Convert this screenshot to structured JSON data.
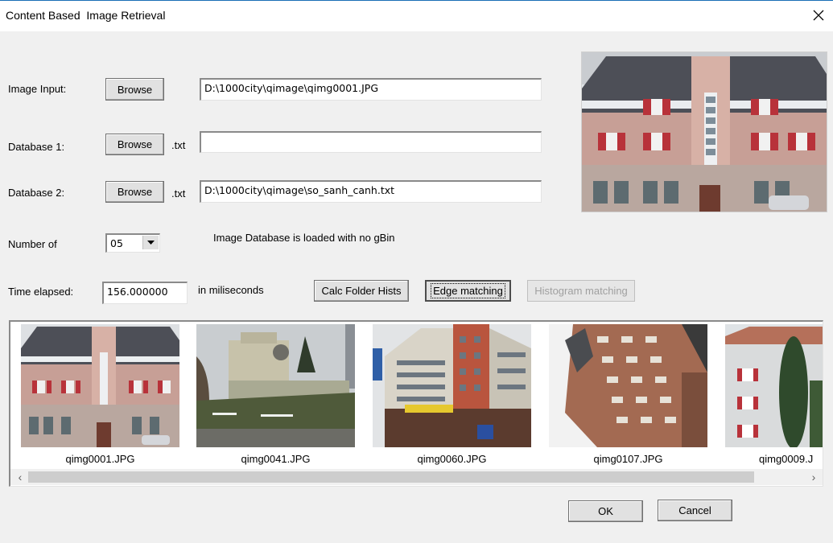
{
  "window": {
    "title": "Content Based  Image Retrieval",
    "close_icon": "close-icon"
  },
  "image_input": {
    "label": "Image Input:",
    "browse_label": "Browse",
    "path": "D:\\1000city\\qimage\\qimg0001.JPG"
  },
  "database1": {
    "label": "Database 1:",
    "browse_label": "Browse",
    "ext_label": ".txt",
    "path": ""
  },
  "database2": {
    "label": "Database 2:",
    "browse_label": "Browse",
    "ext_label": ".txt",
    "path": "D:\\1000city\\qimage\\so_sanh_canh.txt"
  },
  "number_of": {
    "label": "Number of",
    "selected": "05"
  },
  "status_text": "Image Database is loaded with no gBin",
  "time": {
    "label": "Time elapsed:",
    "value": "156.000000",
    "unit_label": "in miliseconds"
  },
  "actions": {
    "calc_label": "Calc Folder Hists",
    "edge_label": "Edge matching",
    "histogram_label": "Histogram matching"
  },
  "results": [
    {
      "filename": "qimg0001.JPG"
    },
    {
      "filename": "qimg0041.JPG"
    },
    {
      "filename": "qimg0060.JPG"
    },
    {
      "filename": "qimg0107.JPG"
    },
    {
      "filename": "qimg0009.J"
    }
  ],
  "footer": {
    "ok_label": "OK",
    "cancel_label": "Cancel"
  },
  "colors": {
    "title_border": "#1a6fb5",
    "dialog_bg": "#f0f0f0",
    "disabled_text": "#a0a0a0"
  }
}
